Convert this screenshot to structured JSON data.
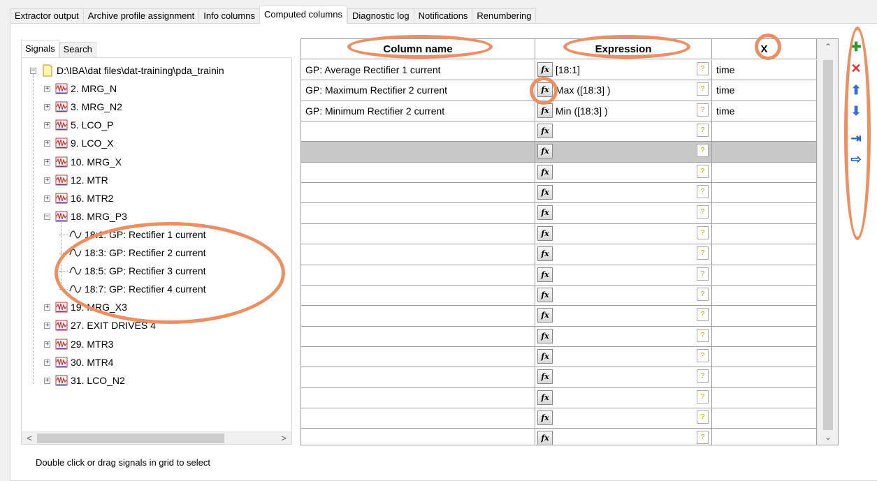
{
  "tabs": [
    "Extractor output",
    "Archive profile assignment",
    "Info columns",
    "Computed columns",
    "Diagnostic log",
    "Notifications",
    "Renumbering"
  ],
  "active_tab": "Computed columns",
  "subtabs": [
    "Signals",
    "Search"
  ],
  "tree": {
    "root": "D:\\IBA\\dat files\\dat-training\\pda_trainin",
    "modules_before": [
      "2. MRG_N",
      "3. MRG_N2",
      "5. LCO_P",
      "9. LCO_X",
      "10. MRG_X",
      "12. MTR",
      "16. MTR2"
    ],
    "expanded_module": "18. MRG_P3",
    "signals": [
      "18:1: GP: Rectifier 1 current",
      "18:3: GP: Rectifier 2 current",
      "18:5: GP: Rectifier 3 current",
      "18:7: GP: Rectifier 4 current"
    ],
    "modules_after": [
      "19. MRG_X3",
      "27. EXIT DRIVES 4",
      "29. MTR3",
      "30. MTR4",
      "31. LCO_N2"
    ]
  },
  "grid": {
    "headers": {
      "column_name": "Column name",
      "expression": "Expression",
      "x": "X"
    },
    "fx_label": "fx",
    "help_glyph": "?",
    "rows": [
      {
        "name": "GP: Average Rectifier 1 current",
        "expression": "[18:1]",
        "x": "time"
      },
      {
        "name": "GP: Maximum Rectifier 2 current",
        "expression": "Max ([18:3] )",
        "x": "time"
      },
      {
        "name": "GP: Minimum Rectifier 2 current",
        "expression": "Min ([18:3] )",
        "x": "time"
      },
      {
        "name": "",
        "expression": "",
        "x": ""
      },
      {
        "name": "",
        "expression": "",
        "x": "",
        "selected": true
      },
      {
        "name": "",
        "expression": "",
        "x": ""
      },
      {
        "name": "",
        "expression": "",
        "x": ""
      },
      {
        "name": "",
        "expression": "",
        "x": ""
      },
      {
        "name": "",
        "expression": "",
        "x": ""
      },
      {
        "name": "",
        "expression": "",
        "x": ""
      },
      {
        "name": "",
        "expression": "",
        "x": ""
      },
      {
        "name": "",
        "expression": "",
        "x": ""
      },
      {
        "name": "",
        "expression": "",
        "x": ""
      },
      {
        "name": "",
        "expression": "",
        "x": ""
      },
      {
        "name": "",
        "expression": "",
        "x": ""
      },
      {
        "name": "",
        "expression": "",
        "x": ""
      },
      {
        "name": "",
        "expression": "",
        "x": ""
      },
      {
        "name": "",
        "expression": "",
        "x": ""
      },
      {
        "name": "",
        "expression": "",
        "x": ""
      },
      {
        "name": "",
        "expression": "",
        "x": ""
      }
    ]
  },
  "toolbar": [
    {
      "name": "add-row-button",
      "icon": "plus-icon",
      "glyph": "✚",
      "color": "#2e9a2e"
    },
    {
      "name": "delete-row-button",
      "icon": "x-icon",
      "glyph": "✕",
      "color": "#e03030"
    },
    {
      "name": "move-up-button",
      "icon": "arrow-up-icon",
      "glyph": "⬆",
      "color": "#3a6fd0"
    },
    {
      "name": "move-down-button",
      "icon": "arrow-down-icon",
      "glyph": "⬇",
      "color": "#3a6fd0"
    },
    {
      "name": "import-button",
      "icon": "import-icon",
      "glyph": "⇥",
      "color": "#2a5fb0"
    },
    {
      "name": "export-button",
      "icon": "export-icon",
      "glyph": "⇨",
      "color": "#2a5fb0"
    }
  ],
  "status_text": "Double click or drag signals in grid to select",
  "colors": {
    "annotation": "#ec8f62",
    "selected_row": "#c8c8c8"
  }
}
